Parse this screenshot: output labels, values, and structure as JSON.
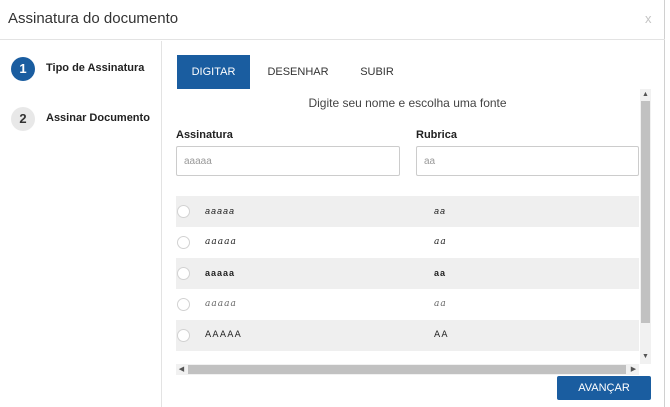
{
  "dialog": {
    "title": "Assinatura do documento",
    "close_label": "x"
  },
  "steps": [
    {
      "number": "1",
      "label": "Tipo de Assinatura",
      "active": true
    },
    {
      "number": "2",
      "label": "Assinar Documento",
      "active": false
    }
  ],
  "tabs": [
    {
      "label": "DIGITAR",
      "active": true
    },
    {
      "label": "DESENHAR",
      "active": false
    },
    {
      "label": "SUBIR",
      "active": false
    }
  ],
  "form": {
    "hint": "Digite seu nome e escolha uma fonte",
    "signature_label": "Assinatura",
    "signature_placeholder": "aaaaa",
    "initials_label": "Rubrica",
    "initials_placeholder": "aa"
  },
  "font_options": [
    {
      "signature": "aaaaa",
      "initials": "aa"
    },
    {
      "signature": "aaaaa",
      "initials": "aa"
    },
    {
      "signature": "aaaaa",
      "initials": "aa"
    },
    {
      "signature": "aaaaa",
      "initials": "aa"
    },
    {
      "signature": "AAAAA",
      "initials": "AA"
    }
  ],
  "scroll": {
    "up": "▲",
    "down": "▼",
    "left": "◀",
    "right": "▶"
  },
  "footer": {
    "next_label": "AVANÇAR"
  },
  "colors": {
    "primary": "#1a5da0",
    "row_stripe": "#efefef"
  }
}
